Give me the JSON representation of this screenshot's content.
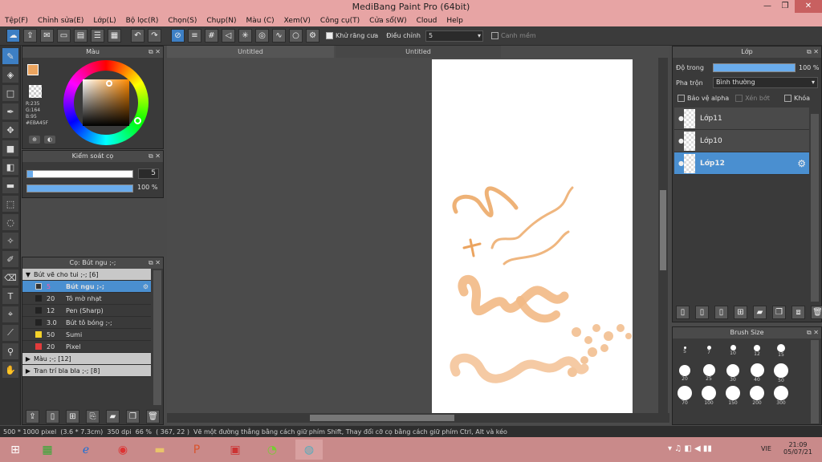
{
  "app": {
    "title": "MediBang Paint Pro (64bit)"
  },
  "menu": [
    "Tệp(F)",
    "Chỉnh sửa(E)",
    "Lớp(L)",
    "Bộ lọc(R)",
    "Chọn(S)",
    "Chụp(N)",
    "Màu (C)",
    "Xem(V)",
    "Công cụ(T)",
    "Cửa sổ(W)",
    "Cloud",
    "Help"
  ],
  "toolbar": {
    "antialias_label": "Khử răng cưa",
    "adjust_label": "Điều chỉnh",
    "adjust_value": "5",
    "smooth_label": "Canh mềm"
  },
  "color_panel": {
    "title": "Màu",
    "r": "R:235",
    "g": "G:164",
    "b": "B:95",
    "hex": "#EBA45F",
    "accent": "#EBA45F"
  },
  "brush_control": {
    "title": "Kiểm soát cọ",
    "size": "5",
    "opacity": "100 %",
    "opacity_level": 1.0,
    "size_level": 0.05
  },
  "brush_panel": {
    "title": "Cọ: Bút ngu ;-;",
    "groups": [
      {
        "name": "Bút vẽ cho tui ;-; [6]",
        "open": true
      },
      {
        "name": "Màu ;-; [12]",
        "open": false
      },
      {
        "name": "Tran trí bla bla ;-; [8]",
        "open": false
      }
    ],
    "items": [
      {
        "size": "5",
        "name": "Bút ngu ;-;",
        "selected": true,
        "color": "#333333"
      },
      {
        "size": "20",
        "name": "Tô mờ nhạt",
        "selected": false,
        "color": "#222222"
      },
      {
        "size": "12",
        "name": "Pen (Sharp)",
        "selected": false,
        "color": "#222222"
      },
      {
        "size": "3.0",
        "name": "Bút tô bóng ;-;",
        "selected": false,
        "color": "#222222"
      },
      {
        "size": "50",
        "name": "Sumi",
        "selected": false,
        "color": "#f4d22a"
      },
      {
        "size": "20",
        "name": "Pixel",
        "selected": false,
        "color": "#e23b3b"
      }
    ]
  },
  "tabs": [
    "Untitled",
    "Untitled"
  ],
  "layers_panel": {
    "title": "Lớp",
    "opacity_label": "Độ trong",
    "opacity_value": "100 %",
    "blend_label": "Pha trộn",
    "blend_value": "Bình thường",
    "protect_alpha": "Bảo vệ alpha",
    "clip": "Xén bớt",
    "lock": "Khóa",
    "layers": [
      {
        "name": "Lớp11",
        "selected": false
      },
      {
        "name": "Lớp10",
        "selected": false
      },
      {
        "name": "Lớp12",
        "selected": true
      }
    ]
  },
  "brush_size_panel": {
    "title": "Brush Size",
    "sizes": [
      "5",
      "7",
      "10",
      "12",
      "15",
      "20",
      "25",
      "30",
      "40",
      "50",
      "70",
      "100",
      "150",
      "200",
      "300"
    ]
  },
  "status": {
    "doc": "500 * 1000 pixel",
    "phys": "(3.6 * 7.3cm)",
    "dpi": "350 dpi",
    "zoom": "66 %",
    "coord": "( 367, 22 )",
    "hint": "Vẽ một đường thẳng bằng cách giữ phím Shift, Thay đổi cỡ cọ bằng cách giữ phím Ctrl, Alt và kéo"
  },
  "taskbar": {
    "lang": "VIE",
    "time": "21:09",
    "date": "05/07/21"
  }
}
